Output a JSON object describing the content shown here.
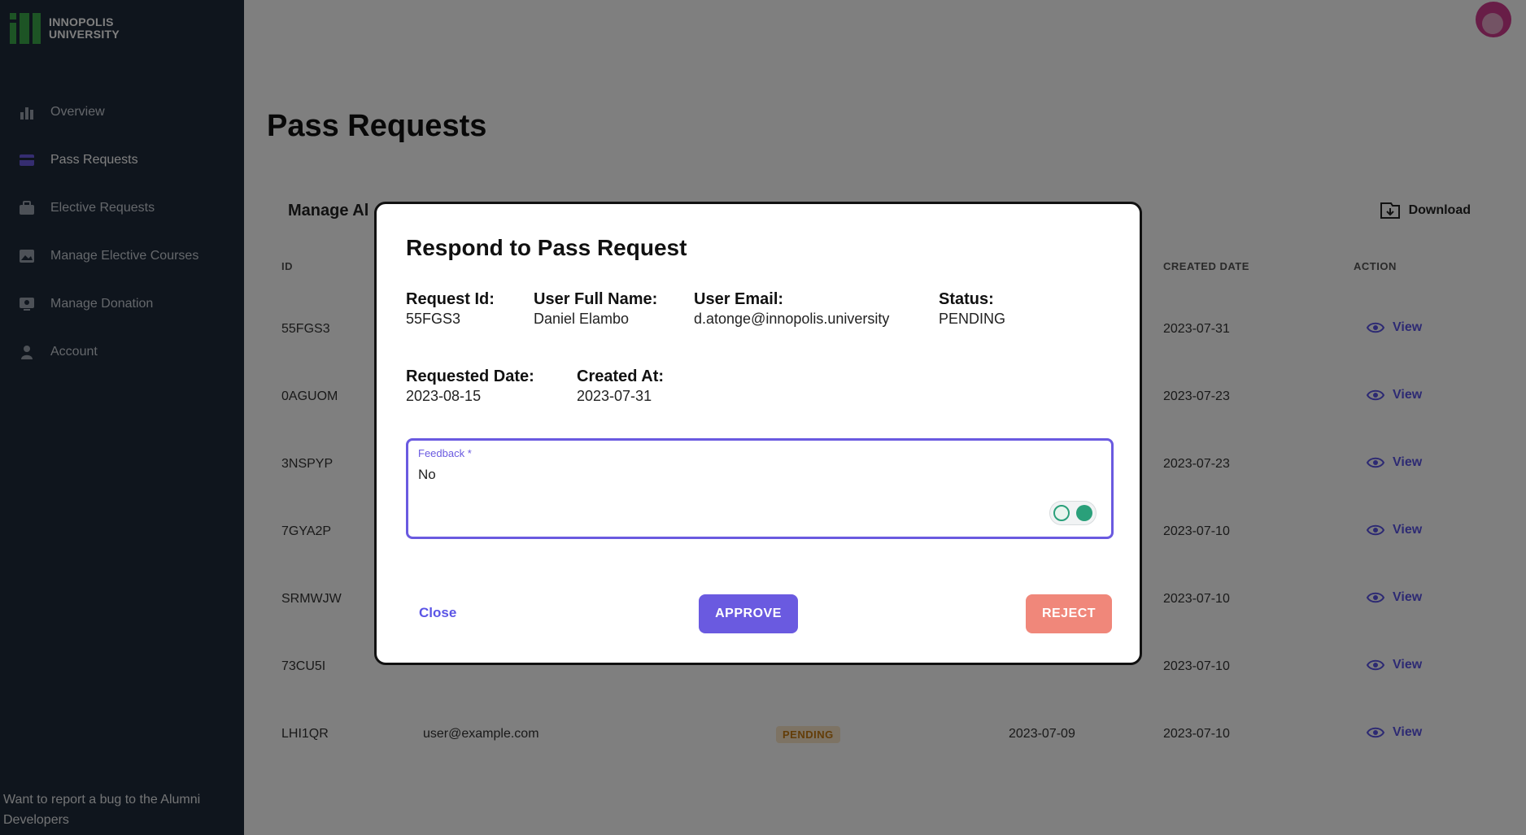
{
  "brand": {
    "line1": "INNOPOLIS",
    "line2": "UNIVERSITY",
    "color": "#3aa84b"
  },
  "sidebar": {
    "items": [
      {
        "label": "Overview",
        "icon": "bar-chart-icon"
      },
      {
        "label": "Pass Requests",
        "icon": "card-icon",
        "active": true
      },
      {
        "label": "Elective Requests",
        "icon": "briefcase-icon"
      },
      {
        "label": "Manage Elective Courses",
        "icon": "image-icon"
      },
      {
        "label": "Manage Donation",
        "icon": "donation-icon"
      },
      {
        "label": "Account",
        "icon": "person-icon"
      }
    ],
    "footer": "Want to report a bug to the Alumni Developers"
  },
  "page": {
    "title": "Pass Requests",
    "card_title": "Manage Al",
    "download_label": "Download"
  },
  "table": {
    "headers": {
      "id": "ID",
      "created_date": "CREATED DATE",
      "action": "ACTION"
    },
    "rows": [
      {
        "id": "55FGS3",
        "created": "2023-07-31",
        "action": "View"
      },
      {
        "id": "0AGUOM",
        "created": "2023-07-23",
        "action": "View"
      },
      {
        "id": "3NSPYP",
        "created": "2023-07-23",
        "action": "View"
      },
      {
        "id": "7GYA2P",
        "created": "2023-07-10",
        "action": "View"
      },
      {
        "id": "SRMWJW",
        "created": "2023-07-10",
        "action": "View"
      },
      {
        "id": "73CU5I",
        "created": "2023-07-10",
        "action": "View"
      },
      {
        "id": "LHI1QR",
        "email": "user@example.com",
        "status": "PENDING",
        "requested": "2023-07-09",
        "created": "2023-07-10",
        "action": "View"
      }
    ]
  },
  "modal": {
    "title": "Respond to Pass Request",
    "request_id_label": "Request Id:",
    "request_id": "55FGS3",
    "full_name_label": "User Full Name:",
    "full_name": "Daniel Elambo",
    "email_label": "User Email:",
    "email": "d.atonge@innopolis.university",
    "status_label": "Status:",
    "status": "PENDING",
    "requested_date_label": "Requested Date:",
    "requested_date": "2023-08-15",
    "created_at_label": "Created At:",
    "created_at": "2023-07-31",
    "feedback_label": "Feedback *",
    "feedback_value": "No",
    "close_label": "Close",
    "approve_label": "APPROVE",
    "reject_label": "REJECT"
  },
  "colors": {
    "sidebar_bg": "#1e2a3a",
    "accent": "#6a5ae0",
    "reject": "#f0877a",
    "overlay": "rgba(0,0,0,0.5)"
  }
}
